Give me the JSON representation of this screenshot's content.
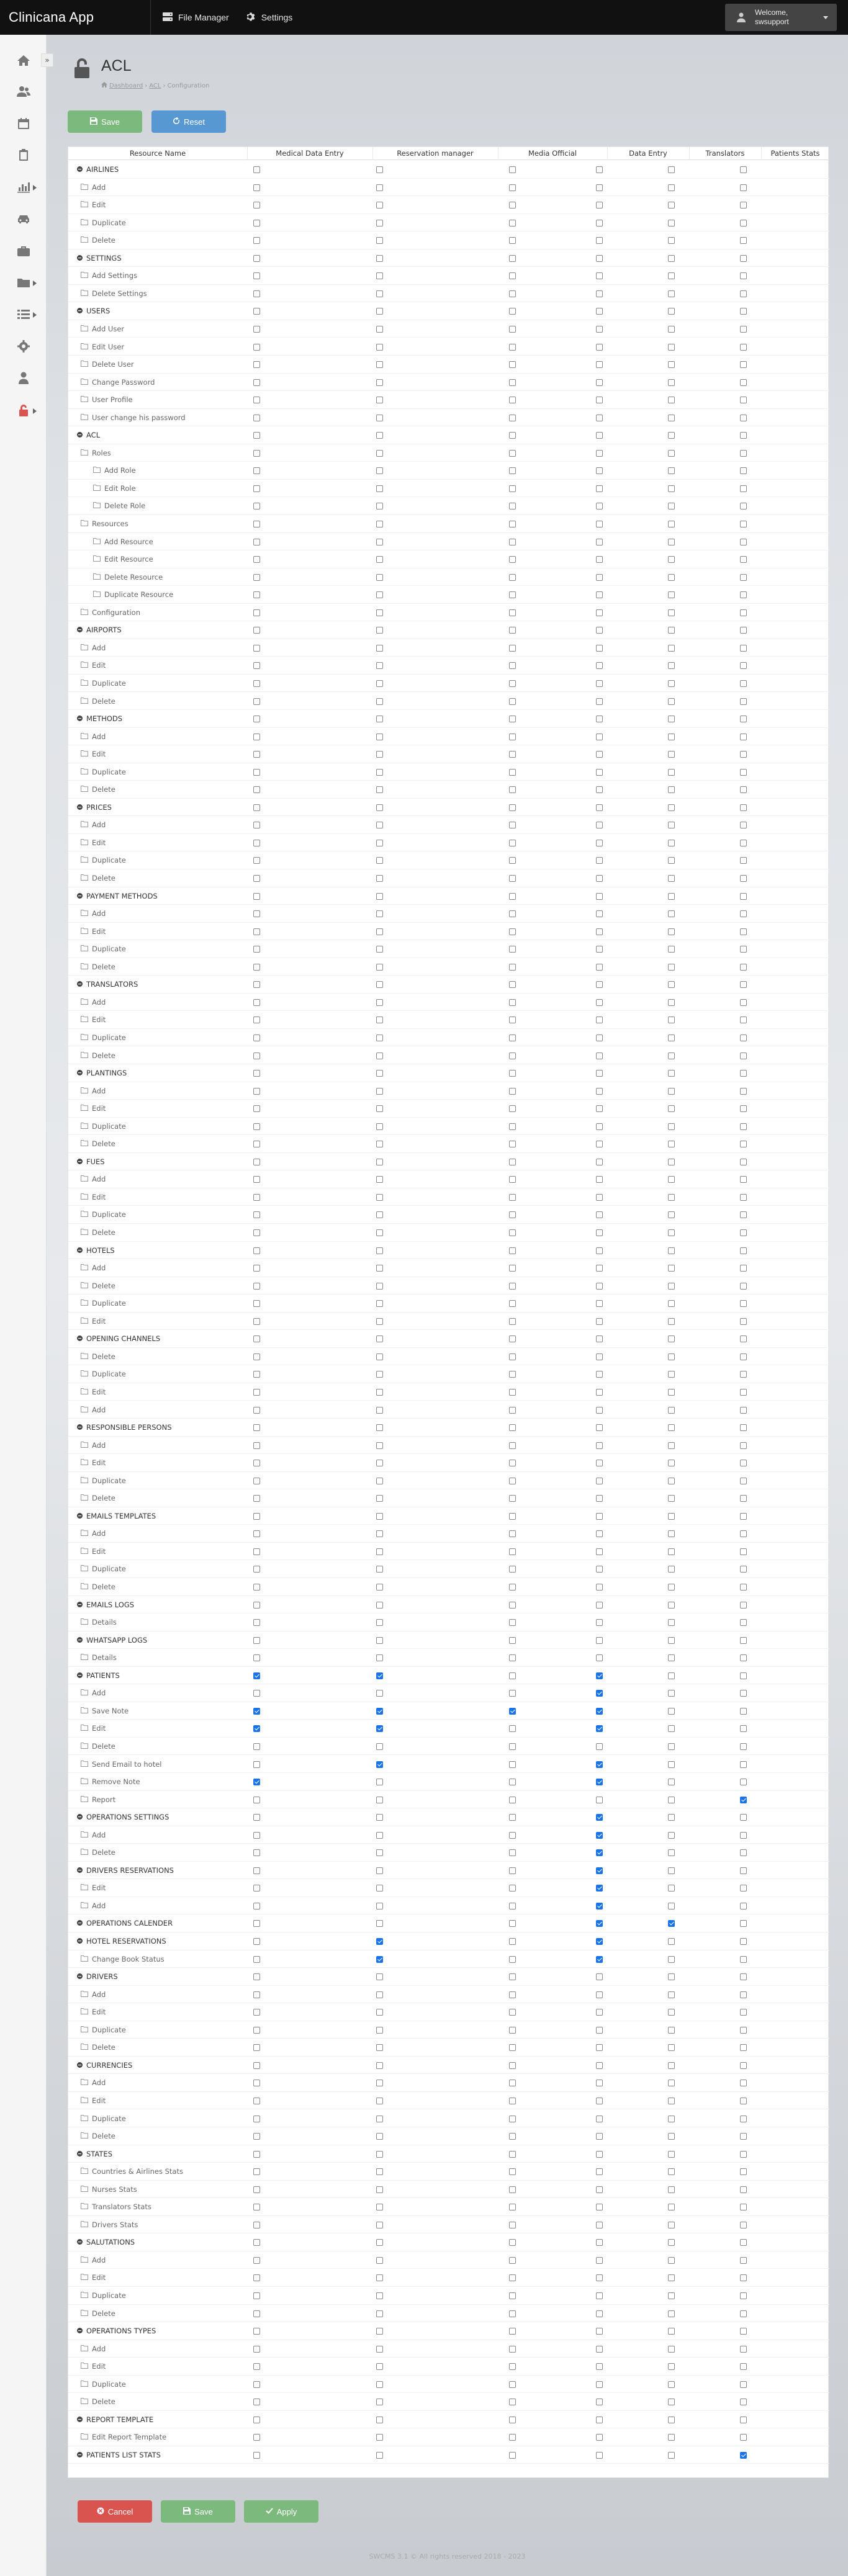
{
  "app": {
    "title": "Clinicana App"
  },
  "topnav": [
    {
      "label": "File Manager",
      "icon": "server-icon"
    },
    {
      "label": "Settings",
      "icon": "gear-icon"
    }
  ],
  "user": {
    "line1": "Welcome,",
    "line2": "swsupport"
  },
  "sidebar": {
    "toggle": "»",
    "items": [
      {
        "icon": "home-icon",
        "chevron": false
      },
      {
        "icon": "users-icon",
        "chevron": false
      },
      {
        "icon": "calendar-icon",
        "chevron": false
      },
      {
        "icon": "clipboard-icon",
        "chevron": false
      },
      {
        "icon": "chart-icon",
        "chevron": true
      },
      {
        "icon": "car-icon",
        "chevron": false
      },
      {
        "icon": "briefcase-icon",
        "chevron": false
      },
      {
        "icon": "folder-icon",
        "chevron": true
      },
      {
        "icon": "list-icon",
        "chevron": true
      },
      {
        "icon": "gear-icon",
        "chevron": false
      },
      {
        "icon": "user-icon",
        "chevron": false
      },
      {
        "icon": "unlock-icon",
        "chevron": true
      }
    ]
  },
  "page": {
    "title": "ACL",
    "breadcrumb": [
      "Dashboard",
      "ACL",
      "Configuration"
    ]
  },
  "buttons": {
    "save": "Save",
    "reset": "Reset",
    "cancel": "Cancel",
    "apply": "Apply"
  },
  "colors": {
    "save": "#7cb97c",
    "reset": "#5797d2",
    "cancel": "#d9534f",
    "checked": "#1a73e8"
  },
  "table": {
    "columns": [
      "Resource Name",
      "Medical Data Entry",
      "Reservation manager",
      "Media Official",
      "Data Entry",
      "Translators",
      "Patients Stats"
    ],
    "rows": [
      {
        "label": "AIRLINES",
        "level": 0,
        "parent": true
      },
      {
        "label": "Add",
        "level": 1
      },
      {
        "label": "Edit",
        "level": 1
      },
      {
        "label": "Duplicate",
        "level": 1
      },
      {
        "label": "Delete",
        "level": 1
      },
      {
        "label": "SETTINGS",
        "level": 0,
        "parent": true
      },
      {
        "label": "Add Settings",
        "level": 1
      },
      {
        "label": "Delete Settings",
        "level": 1
      },
      {
        "label": "USERS",
        "level": 0,
        "parent": true
      },
      {
        "label": "Add User",
        "level": 1
      },
      {
        "label": "Edit User",
        "level": 1
      },
      {
        "label": "Delete User",
        "level": 1
      },
      {
        "label": "Change Password",
        "level": 1
      },
      {
        "label": "User Profile",
        "level": 1
      },
      {
        "label": "User change his password",
        "level": 1
      },
      {
        "label": "ACL",
        "level": 0,
        "parent": true
      },
      {
        "label": "Roles",
        "level": 1
      },
      {
        "label": "Add Role",
        "level": 2
      },
      {
        "label": "Edit Role",
        "level": 2
      },
      {
        "label": "Delete Role",
        "level": 2
      },
      {
        "label": "Resources",
        "level": 1
      },
      {
        "label": "Add Resource",
        "level": 2
      },
      {
        "label": "Edit Resource",
        "level": 2
      },
      {
        "label": "Delete Resource",
        "level": 2
      },
      {
        "label": "Duplicate Resource",
        "level": 2
      },
      {
        "label": "Configuration",
        "level": 1
      },
      {
        "label": "AIRPORTS",
        "level": 0,
        "parent": true
      },
      {
        "label": "Add",
        "level": 1
      },
      {
        "label": "Edit",
        "level": 1
      },
      {
        "label": "Duplicate",
        "level": 1
      },
      {
        "label": "Delete",
        "level": 1
      },
      {
        "label": "METHODS",
        "level": 0,
        "parent": true
      },
      {
        "label": "Add",
        "level": 1
      },
      {
        "label": "Edit",
        "level": 1
      },
      {
        "label": "Duplicate",
        "level": 1
      },
      {
        "label": "Delete",
        "level": 1
      },
      {
        "label": "PRICES",
        "level": 0,
        "parent": true
      },
      {
        "label": "Add",
        "level": 1
      },
      {
        "label": "Edit",
        "level": 1
      },
      {
        "label": "Duplicate",
        "level": 1
      },
      {
        "label": "Delete",
        "level": 1
      },
      {
        "label": "PAYMENT METHODS",
        "level": 0,
        "parent": true
      },
      {
        "label": "Add",
        "level": 1
      },
      {
        "label": "Edit",
        "level": 1
      },
      {
        "label": "Duplicate",
        "level": 1
      },
      {
        "label": "Delete",
        "level": 1
      },
      {
        "label": "TRANSLATORS",
        "level": 0,
        "parent": true
      },
      {
        "label": "Add",
        "level": 1
      },
      {
        "label": "Edit",
        "level": 1
      },
      {
        "label": "Duplicate",
        "level": 1
      },
      {
        "label": "Delete",
        "level": 1
      },
      {
        "label": "PLANTINGS",
        "level": 0,
        "parent": true
      },
      {
        "label": "Add",
        "level": 1
      },
      {
        "label": "Edit",
        "level": 1
      },
      {
        "label": "Duplicate",
        "level": 1
      },
      {
        "label": "Delete",
        "level": 1
      },
      {
        "label": "FUES",
        "level": 0,
        "parent": true
      },
      {
        "label": "Add",
        "level": 1
      },
      {
        "label": "Edit",
        "level": 1
      },
      {
        "label": "Duplicate",
        "level": 1
      },
      {
        "label": "Delete",
        "level": 1
      },
      {
        "label": "HOTELS",
        "level": 0,
        "parent": true
      },
      {
        "label": "Add",
        "level": 1
      },
      {
        "label": "Delete",
        "level": 1
      },
      {
        "label": "Duplicate",
        "level": 1
      },
      {
        "label": "Edit",
        "level": 1
      },
      {
        "label": "OPENING CHANNELS",
        "level": 0,
        "parent": true
      },
      {
        "label": "Delete",
        "level": 1
      },
      {
        "label": "Duplicate",
        "level": 1
      },
      {
        "label": "Edit",
        "level": 1
      },
      {
        "label": "Add",
        "level": 1
      },
      {
        "label": "RESPONSIBLE PERSONS",
        "level": 0,
        "parent": true
      },
      {
        "label": "Add",
        "level": 1
      },
      {
        "label": "Edit",
        "level": 1
      },
      {
        "label": "Duplicate",
        "level": 1
      },
      {
        "label": "Delete",
        "level": 1
      },
      {
        "label": "EMAILS TEMPLATES",
        "level": 0,
        "parent": true
      },
      {
        "label": "Add",
        "level": 1
      },
      {
        "label": "Edit",
        "level": 1
      },
      {
        "label": "Duplicate",
        "level": 1
      },
      {
        "label": "Delete",
        "level": 1
      },
      {
        "label": "EMAILS LOGS",
        "level": 0,
        "parent": true
      },
      {
        "label": "Details",
        "level": 1
      },
      {
        "label": "WHATSAPP LOGS",
        "level": 0,
        "parent": true
      },
      {
        "label": "Details",
        "level": 1
      },
      {
        "label": "PATIENTS",
        "level": 0,
        "parent": true,
        "checks": [
          1,
          1,
          0,
          1,
          0,
          0
        ]
      },
      {
        "label": "Add",
        "level": 1,
        "checks": [
          0,
          0,
          0,
          1,
          0,
          0
        ]
      },
      {
        "label": "Save Note",
        "level": 1,
        "checks": [
          1,
          1,
          1,
          1,
          0,
          0
        ]
      },
      {
        "label": "Edit",
        "level": 1,
        "checks": [
          1,
          1,
          0,
          1,
          0,
          0
        ]
      },
      {
        "label": "Delete",
        "level": 1
      },
      {
        "label": "Send Email to hotel",
        "level": 1,
        "checks": [
          0,
          1,
          0,
          1,
          0,
          0
        ]
      },
      {
        "label": "Remove Note",
        "level": 1,
        "checks": [
          1,
          0,
          0,
          1,
          0,
          0
        ]
      },
      {
        "label": "Report",
        "level": 1,
        "checks": [
          0,
          0,
          0,
          0,
          0,
          1
        ]
      },
      {
        "label": "OPERATIONS SETTINGS",
        "level": 0,
        "parent": true,
        "checks": [
          0,
          0,
          0,
          1,
          0,
          0
        ]
      },
      {
        "label": "Add",
        "level": 1,
        "checks": [
          0,
          0,
          0,
          1,
          0,
          0
        ]
      },
      {
        "label": "Delete",
        "level": 1,
        "checks": [
          0,
          0,
          0,
          1,
          0,
          0
        ]
      },
      {
        "label": "DRIVERS RESERVATIONS",
        "level": 0,
        "parent": true,
        "checks": [
          0,
          0,
          0,
          1,
          0,
          0
        ]
      },
      {
        "label": "Edit",
        "level": 1,
        "checks": [
          0,
          0,
          0,
          1,
          0,
          0
        ]
      },
      {
        "label": "Add",
        "level": 1,
        "checks": [
          0,
          0,
          0,
          1,
          0,
          0
        ]
      },
      {
        "label": "OPERATIONS CALENDER",
        "level": 0,
        "parent": true,
        "checks": [
          0,
          0,
          0,
          1,
          1,
          0
        ]
      },
      {
        "label": "HOTEL RESERVATIONS",
        "level": 0,
        "parent": true,
        "checks": [
          0,
          1,
          0,
          1,
          0,
          0
        ]
      },
      {
        "label": "Change Book Status",
        "level": 1,
        "checks": [
          0,
          1,
          0,
          1,
          0,
          0
        ]
      },
      {
        "label": "DRIVERS",
        "level": 0,
        "parent": true
      },
      {
        "label": "Add",
        "level": 1
      },
      {
        "label": "Edit",
        "level": 1
      },
      {
        "label": "Duplicate",
        "level": 1
      },
      {
        "label": "Delete",
        "level": 1
      },
      {
        "label": "CURRENCIES",
        "level": 0,
        "parent": true
      },
      {
        "label": "Add",
        "level": 1
      },
      {
        "label": "Edit",
        "level": 1
      },
      {
        "label": "Duplicate",
        "level": 1
      },
      {
        "label": "Delete",
        "level": 1
      },
      {
        "label": "STATES",
        "level": 0,
        "parent": true
      },
      {
        "label": "Countries & Airlines Stats",
        "level": 1
      },
      {
        "label": "Nurses Stats",
        "level": 1
      },
      {
        "label": "Translators Stats",
        "level": 1
      },
      {
        "label": "Drivers Stats",
        "level": 1
      },
      {
        "label": "SALUTATIONS",
        "level": 0,
        "parent": true
      },
      {
        "label": "Add",
        "level": 1
      },
      {
        "label": "Edit",
        "level": 1
      },
      {
        "label": "Duplicate",
        "level": 1
      },
      {
        "label": "Delete",
        "level": 1
      },
      {
        "label": "OPERATIONS TYPES",
        "level": 0,
        "parent": true
      },
      {
        "label": "Add",
        "level": 1
      },
      {
        "label": "Edit",
        "level": 1
      },
      {
        "label": "Duplicate",
        "level": 1
      },
      {
        "label": "Delete",
        "level": 1
      },
      {
        "label": "REPORT TEMPLATE",
        "level": 0,
        "parent": true
      },
      {
        "label": "Edit Report Template",
        "level": 1
      },
      {
        "label": "PATIENTS LIST STATS",
        "level": 0,
        "parent": true,
        "checks": [
          0,
          0,
          0,
          0,
          0,
          1
        ]
      }
    ]
  },
  "footer": "SWCMS 3.1 © All rights reserved 2018 - 2023"
}
